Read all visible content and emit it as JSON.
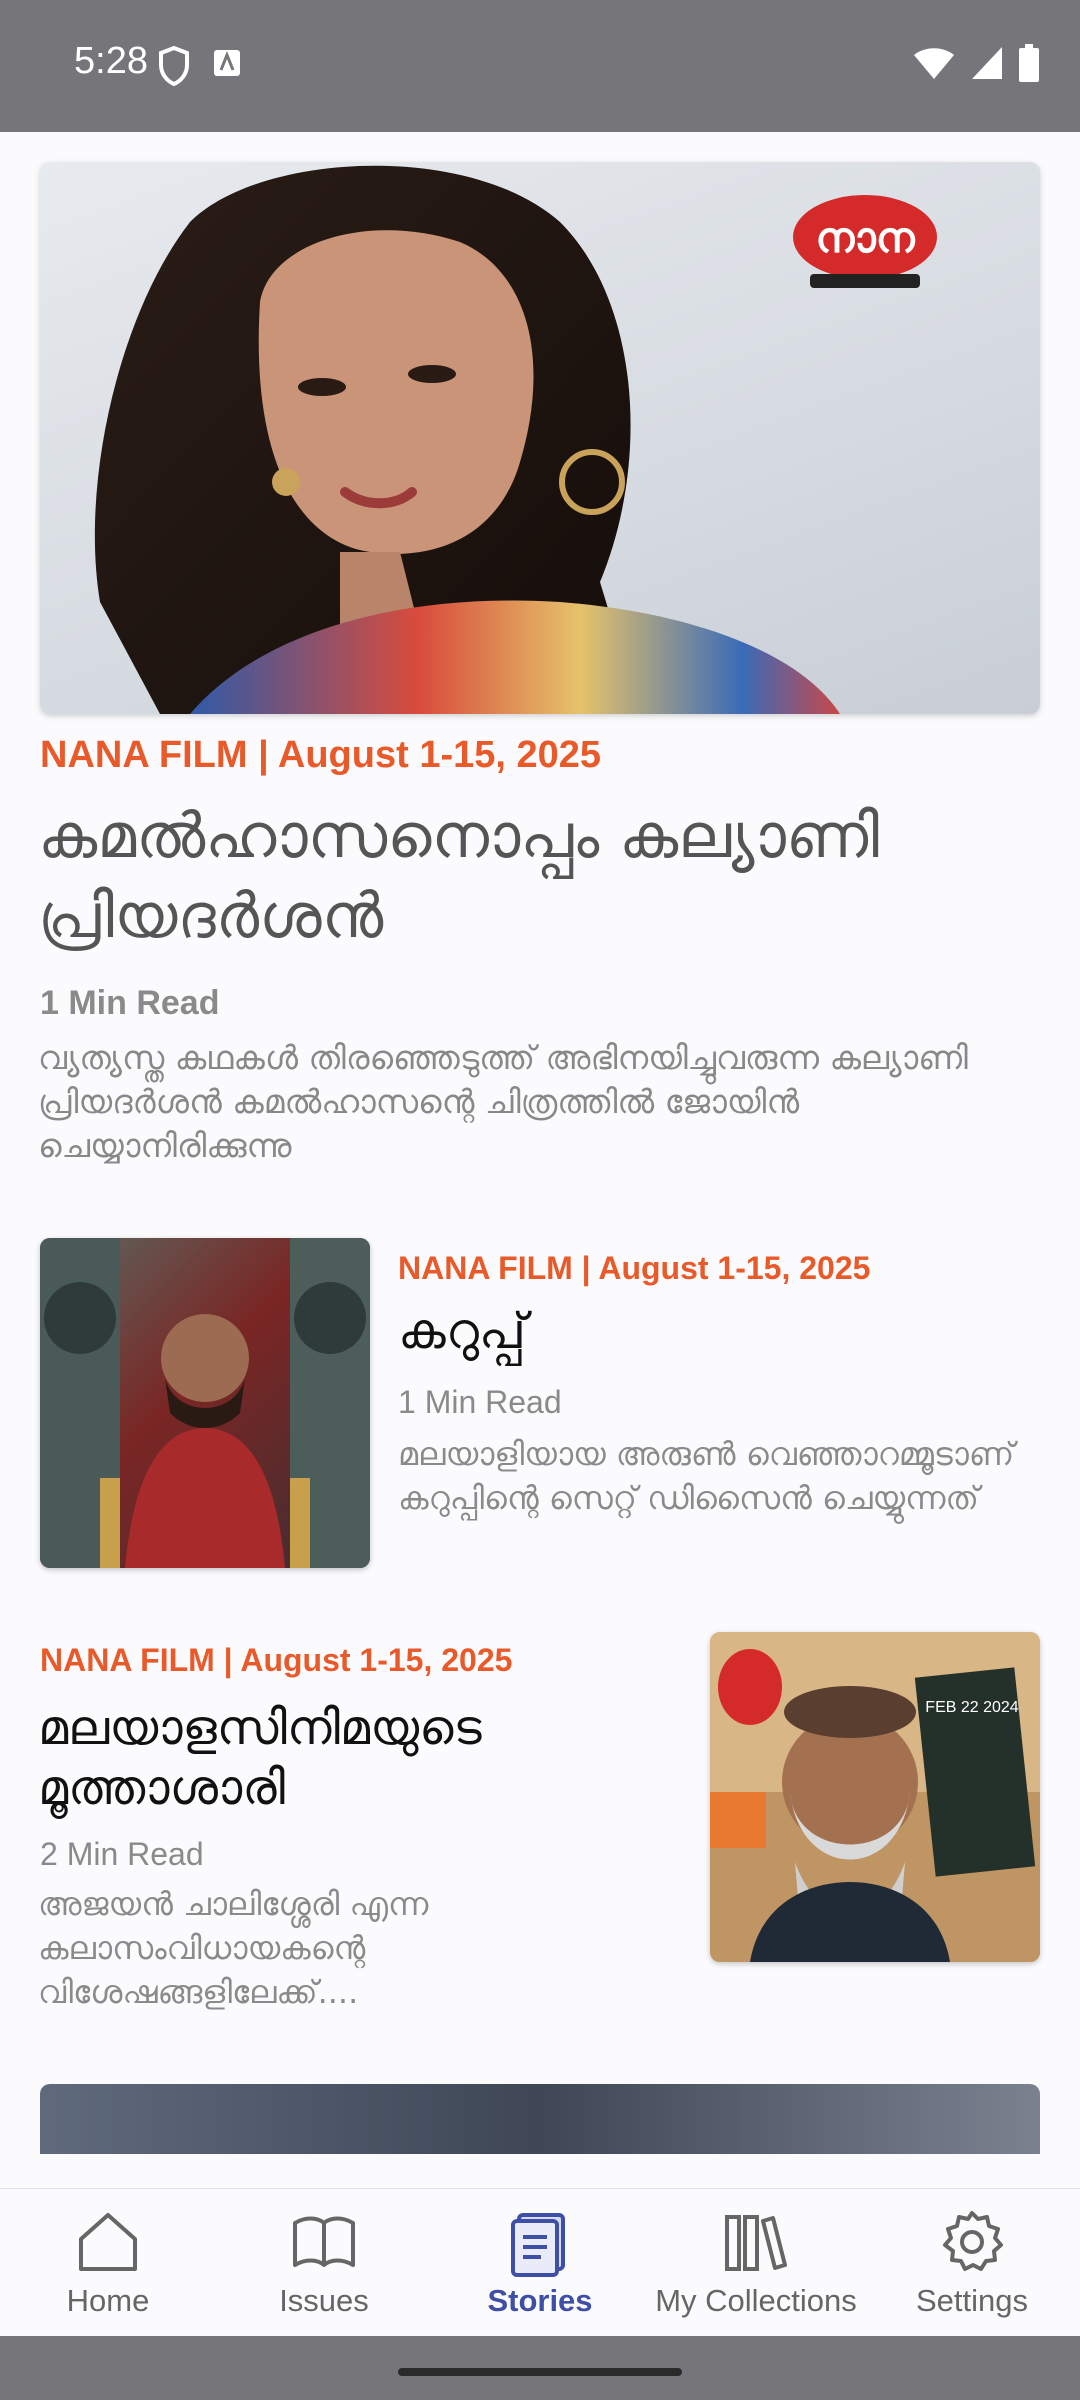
{
  "status_bar": {
    "time": "5:28"
  },
  "articles": [
    {
      "meta": "NANA FILM | August 1-15, 2025",
      "title": "കമൽഹാസനൊപ്പം കല്യാണി പ്രിയദർശൻ",
      "read_time": "1 Min Read",
      "description": "വ്യത്യസ്ത കഥകൾ തിരഞ്ഞെടുത്ത് അഭിനയിച്ചുവരുന്ന കല്യാണി പ്രിയദർശൻ കമൽഹാസന്റെ ചിത്രത്തിൽ ജോയിൻ ചെയ്യാനിരിക്കുന്നു"
    },
    {
      "meta": "NANA FILM | August 1-15, 2025",
      "title": "കറുപ്പ്",
      "read_time": "1 Min Read",
      "description": "മലയാളിയായ അരുൺ വെഞ്ഞാറമ്മൂടാണ് കറുപ്പിന്റെ സെറ്റ് ഡിസൈൻ ചെയ്യുന്നത്"
    },
    {
      "meta": "NANA FILM | August 1-15, 2025",
      "title": "മലയാളസിനിമയുടെ മൂത്താശാരി",
      "read_time": "2 Min Read",
      "description": "അജയൻ ചാലിശ്ശേരി എന്ന കലാസംവിധായകന്റെ വിശേഷങ്ങളിലേക്ക്....",
      "poster_text": "FEB 22 2024"
    }
  ],
  "logo_text": "നാന",
  "bottom_nav": [
    {
      "label": "Home",
      "icon": "home-icon",
      "active": false
    },
    {
      "label": "Issues",
      "icon": "book-icon",
      "active": false
    },
    {
      "label": "Stories",
      "icon": "stories-icon",
      "active": true
    },
    {
      "label": "My Collections",
      "icon": "collections-icon",
      "active": false
    },
    {
      "label": "Settings",
      "icon": "gear-icon",
      "active": false
    }
  ],
  "colors": {
    "accent": "#e85a2a",
    "nav_active": "#3e4fa5",
    "status_bar": "#76767a"
  }
}
